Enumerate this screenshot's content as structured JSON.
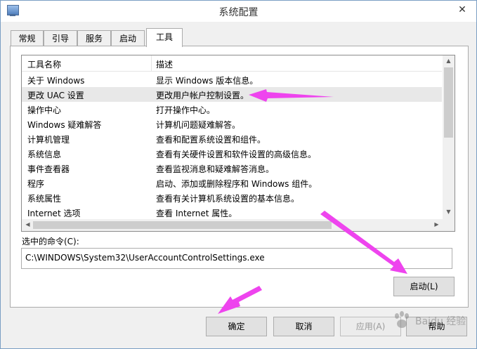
{
  "window": {
    "title": "系统配置",
    "close_symbol": "✕"
  },
  "tabs": [
    {
      "label": "常规"
    },
    {
      "label": "引导"
    },
    {
      "label": "服务"
    },
    {
      "label": "启动"
    },
    {
      "label": "工具"
    }
  ],
  "list": {
    "col_name": "工具名称",
    "col_desc": "描述",
    "rows": [
      {
        "name": "关于 Windows",
        "desc": "显示 Windows 版本信息。"
      },
      {
        "name": "更改 UAC 设置",
        "desc": "更改用户帐户控制设置。"
      },
      {
        "name": "操作中心",
        "desc": "打开操作中心。"
      },
      {
        "name": "Windows 疑难解答",
        "desc": "计算机问题疑难解答。"
      },
      {
        "name": "计算机管理",
        "desc": "查看和配置系统设置和组件。"
      },
      {
        "name": "系统信息",
        "desc": "查看有关硬件设置和软件设置的高级信息。"
      },
      {
        "name": "事件查看器",
        "desc": "查看监视消息和疑难解答消息。"
      },
      {
        "name": "程序",
        "desc": "启动、添加或删除程序和 Windows 组件。"
      },
      {
        "name": "系统属性",
        "desc": "查看有关计算机系统设置的基本信息。"
      },
      {
        "name": "Internet 选项",
        "desc": "查看 Internet 属性。"
      }
    ]
  },
  "command": {
    "label": "选中的命令(C):",
    "value": "C:\\WINDOWS\\System32\\UserAccountControlSettings.exe"
  },
  "buttons": {
    "launch": "启动(L)",
    "ok": "确定",
    "cancel": "取消",
    "apply": "应用(A)",
    "help": "帮助"
  },
  "watermark": {
    "text": "Baidu 经验"
  },
  "colors": {
    "annotation_arrow": "#ee44ee"
  }
}
